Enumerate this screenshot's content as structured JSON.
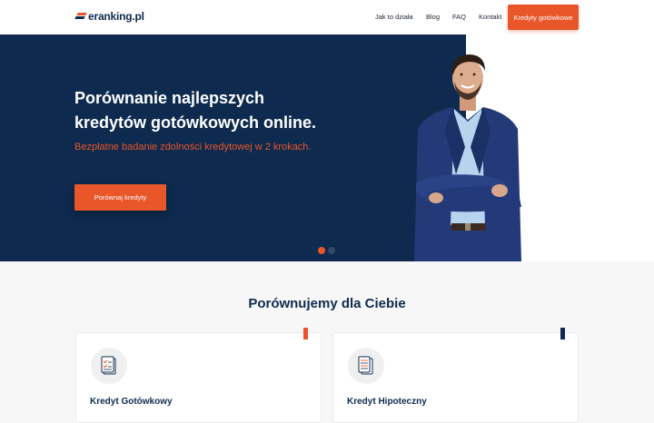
{
  "header": {
    "logo_text": "eranking.pl",
    "nav": [
      {
        "label": "Jak to działa"
      },
      {
        "label": "Blog"
      },
      {
        "label": "FAQ"
      },
      {
        "label": "Kontakt"
      }
    ],
    "cta_label": "Kredyty gotówkowe"
  },
  "hero": {
    "title_line1": "Porównanie najlepszych",
    "title_line2": "kredytów gotówkowych online.",
    "subtitle": "Bezpłatne badanie zdolności kredytowej w 2 krokach.",
    "button_label": "Porównaj kredyty",
    "slides": {
      "count": 2,
      "active": 1
    }
  },
  "section": {
    "title": "Porównujemy dla Ciebie",
    "cards": [
      {
        "title": "Kredyt Gotówkowy",
        "icon": "document-checklist-icon",
        "accent": "#e8562a"
      },
      {
        "title": "Kredyt Hipoteczny",
        "icon": "document-list-icon",
        "accent": "#0f2b4f"
      }
    ]
  },
  "colors": {
    "brand_orange": "#e8562a",
    "brand_navy": "#0e2a4e"
  }
}
